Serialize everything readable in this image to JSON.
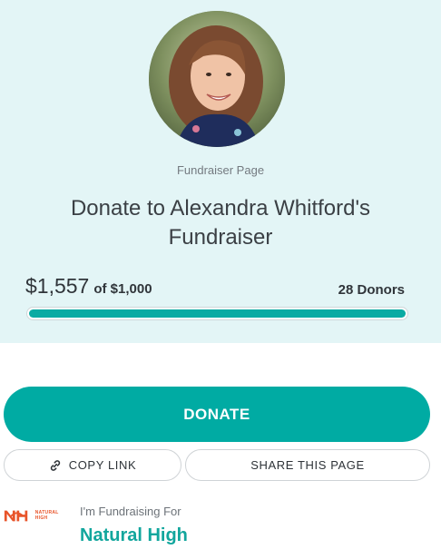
{
  "page": {
    "eyebrow": "Fundraiser Page",
    "title": "Donate to Alexandra Whitford's Fundraiser"
  },
  "profile": {
    "avatar_icon": "person-photo"
  },
  "progress": {
    "raised": "$1,557",
    "goal_text": "of $1,000",
    "donors": "28 Donors",
    "fill_fraction": 1.0
  },
  "actions": {
    "donate_label": "DONATE",
    "copy_link_label": "COPY LINK",
    "copy_link_icon": "link-icon",
    "share_label": "SHARE THIS PAGE"
  },
  "organization": {
    "for_label": "I'm Fundraising For",
    "name": "Natural High",
    "logo_text": "NATURAL HIGH"
  },
  "colors": {
    "hero_bg": "#e3f5f6",
    "accent": "#00aba3",
    "org_name": "#12a69d",
    "logo": "#e8542a"
  }
}
